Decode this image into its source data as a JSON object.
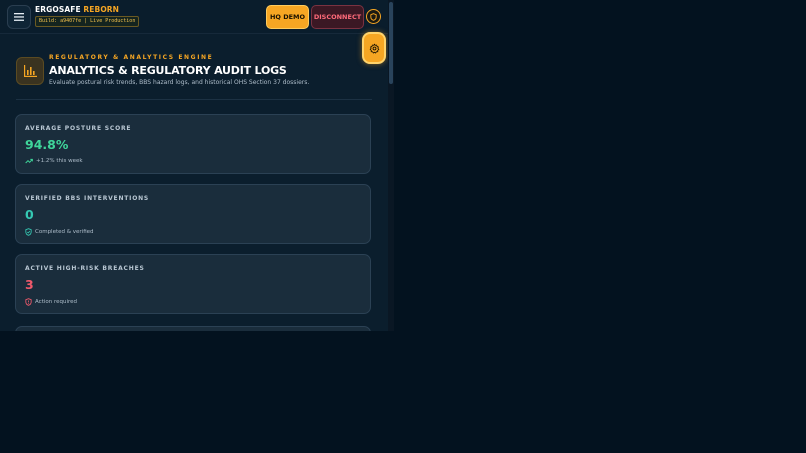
{
  "topbar": {
    "brand_primary": "ERGOSAFE",
    "brand_accent": "REBORN",
    "build_label": "Build: a9407fe | Live Production",
    "hq_demo_label": "HQ DEMO",
    "disconnect_label": "DISCONNECT"
  },
  "header": {
    "kicker": "REGULATORY & ANALYTICS ENGINE",
    "title": "ANALYTICS & REGULATORY AUDIT LOGS",
    "subtitle": "Evaluate postural risk trends, BBS hazard logs, and historical OHS Section 37 dossiers."
  },
  "cards": [
    {
      "label": "AVERAGE POSTURE SCORE",
      "value": "94.8%",
      "note": "+1.2% this week",
      "color": "#3fd69a",
      "icon": "trend-up-icon"
    },
    {
      "label": "VERIFIED BBS INTERVENTIONS",
      "value": "0",
      "note": "Completed & verified",
      "color": "#35c9b3",
      "icon": "shield-check-icon"
    },
    {
      "label": "ACTIVE HIGH-RISK BREACHES",
      "value": "3",
      "note": "Action required",
      "color": "#f0596b",
      "icon": "shield-alert-icon"
    }
  ],
  "colors": {
    "accent": "#f6a623",
    "danger": "#ff6b7a",
    "background": "#0b1e2d"
  }
}
